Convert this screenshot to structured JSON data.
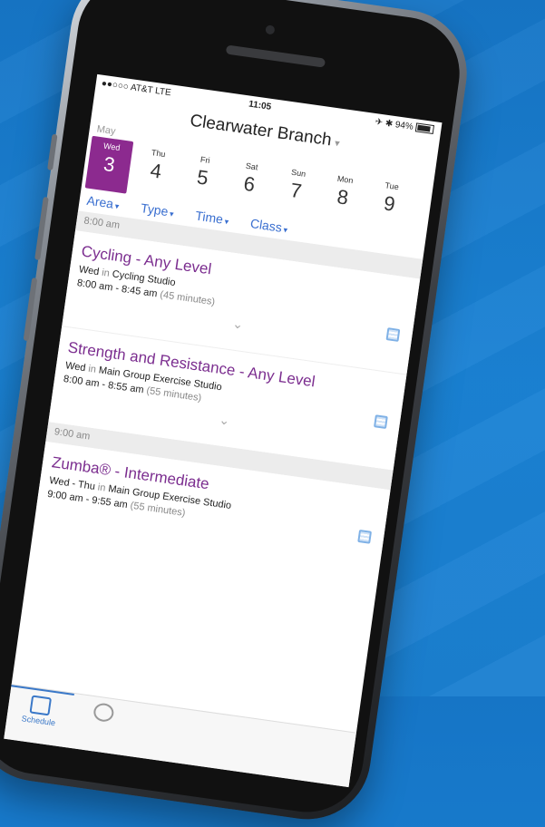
{
  "status": {
    "carrier": "●●○○○ AT&T  LTE",
    "time": "11:05",
    "battery": "✈ ✱ 94%"
  },
  "header": {
    "title": "Clearwater Branch"
  },
  "calendar": {
    "month": "May",
    "days": [
      {
        "dow": "Wed",
        "num": "3"
      },
      {
        "dow": "Thu",
        "num": "4"
      },
      {
        "dow": "Fri",
        "num": "5"
      },
      {
        "dow": "Sat",
        "num": "6"
      },
      {
        "dow": "Sun",
        "num": "7"
      },
      {
        "dow": "Mon",
        "num": "8"
      },
      {
        "dow": "Tue",
        "num": "9"
      }
    ]
  },
  "filters": [
    "Area",
    "Type",
    "Time",
    "Class"
  ],
  "sections": [
    {
      "time": "8:00 am",
      "classes": [
        {
          "name": "Cycling - Any Level",
          "days": "Wed",
          "room": "Cycling Studio",
          "hours": "8:00 am - 8:45 am",
          "duration": "(45 minutes)"
        },
        {
          "name": "Strength and Resistance - Any Level",
          "days": "Wed",
          "room": "Main Group Exercise Studio",
          "hours": "8:00 am - 8:55 am",
          "duration": "(55 minutes)"
        }
      ]
    },
    {
      "time": "9:00 am",
      "classes": [
        {
          "name": "Zumba® - Intermediate",
          "days": "Wed - Thu",
          "room": "Main Group Exercise Studio",
          "hours": "9:00 am - 9:55 am",
          "duration": "(55 minutes)"
        }
      ]
    }
  ],
  "in_word": "in",
  "tabs": [
    {
      "label": "Schedule"
    }
  ],
  "colors": {
    "accent": "#8c2a8f",
    "link": "#3a6fd0",
    "background": "#1a7fd0"
  }
}
